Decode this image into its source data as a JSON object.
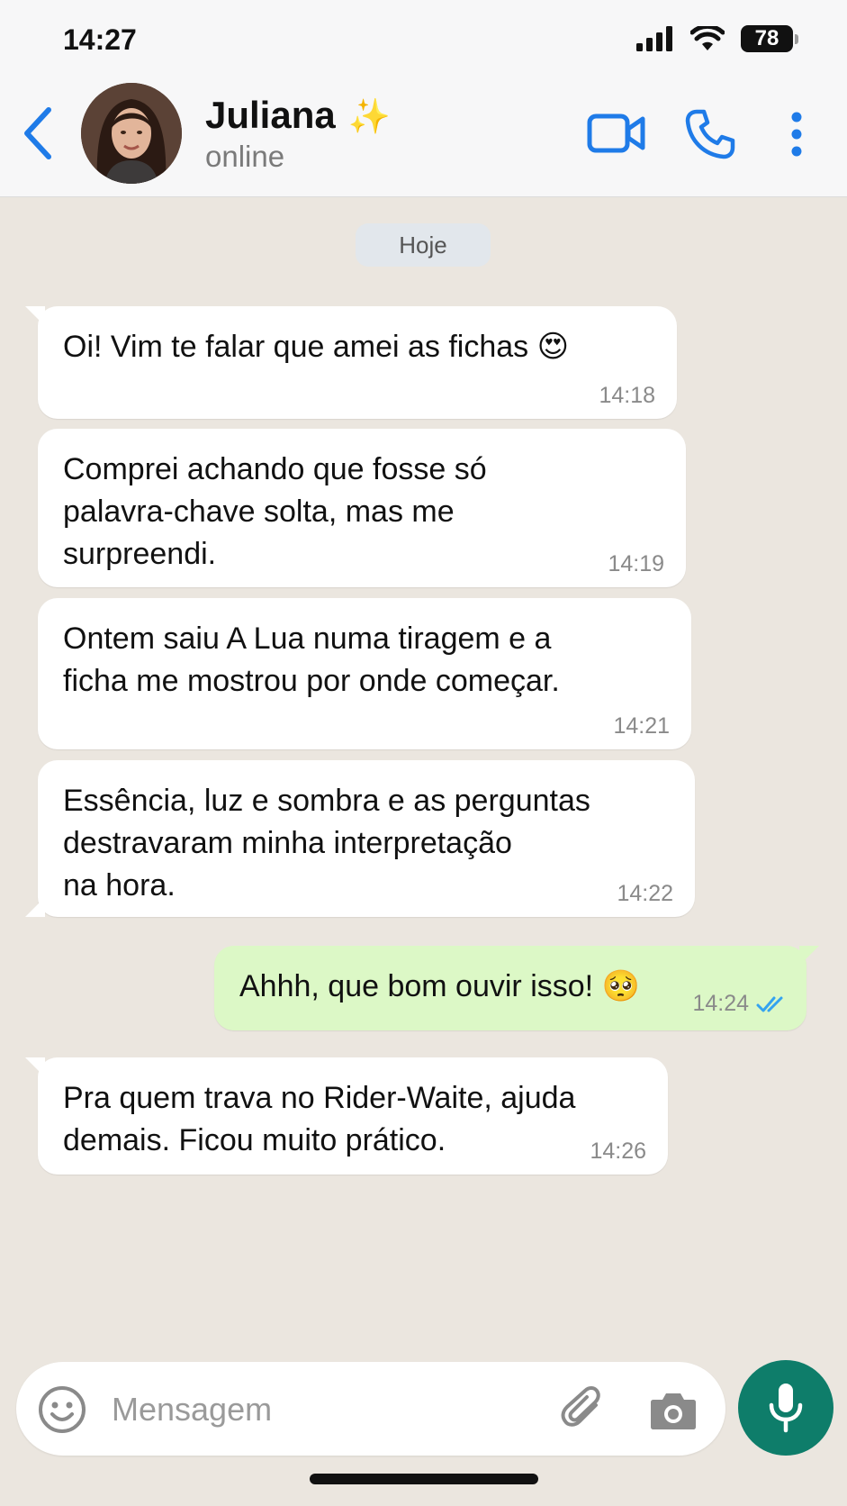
{
  "status_bar": {
    "time": "14:27",
    "battery": "78"
  },
  "header": {
    "contact_name": "Juliana",
    "contact_emoji": "✨",
    "contact_status": "online",
    "accent_color": "#1f7be8"
  },
  "chat": {
    "date_label": "Hoje",
    "messages": [
      {
        "direction": "incoming",
        "text": "Oi! Vim te falar que amei as fichas 😍",
        "time": "14:18"
      },
      {
        "direction": "incoming",
        "lines": [
          "Comprei achando que fosse só",
          "palavra-chave solta, mas me",
          "surpreendi."
        ],
        "time": "14:19"
      },
      {
        "direction": "incoming",
        "lines": [
          "Ontem saiu A Lua numa tiragem e a",
          "ficha me mostrou por onde começar."
        ],
        "time": "14:21"
      },
      {
        "direction": "incoming",
        "lines": [
          "Essência, luz e sombra e as perguntas",
          "destravaram minha interpretação",
          "na hora."
        ],
        "time": "14:22"
      },
      {
        "direction": "outgoing",
        "text": "Ahhh, que bom ouvir isso! 🥺",
        "time": "14:24",
        "status": "read"
      },
      {
        "direction": "incoming",
        "lines": [
          "Pra quem trava no Rider-Waite, ajuda",
          "demais. Ficou muito prático."
        ],
        "time": "14:26"
      }
    ]
  },
  "composer": {
    "placeholder": "Mensagem",
    "emoji_icon": "smiley-icon",
    "attach_icon": "paperclip-icon",
    "camera_icon": "camera-icon",
    "mic_icon": "microphone-icon",
    "mic_color": "#0e7d6a"
  }
}
